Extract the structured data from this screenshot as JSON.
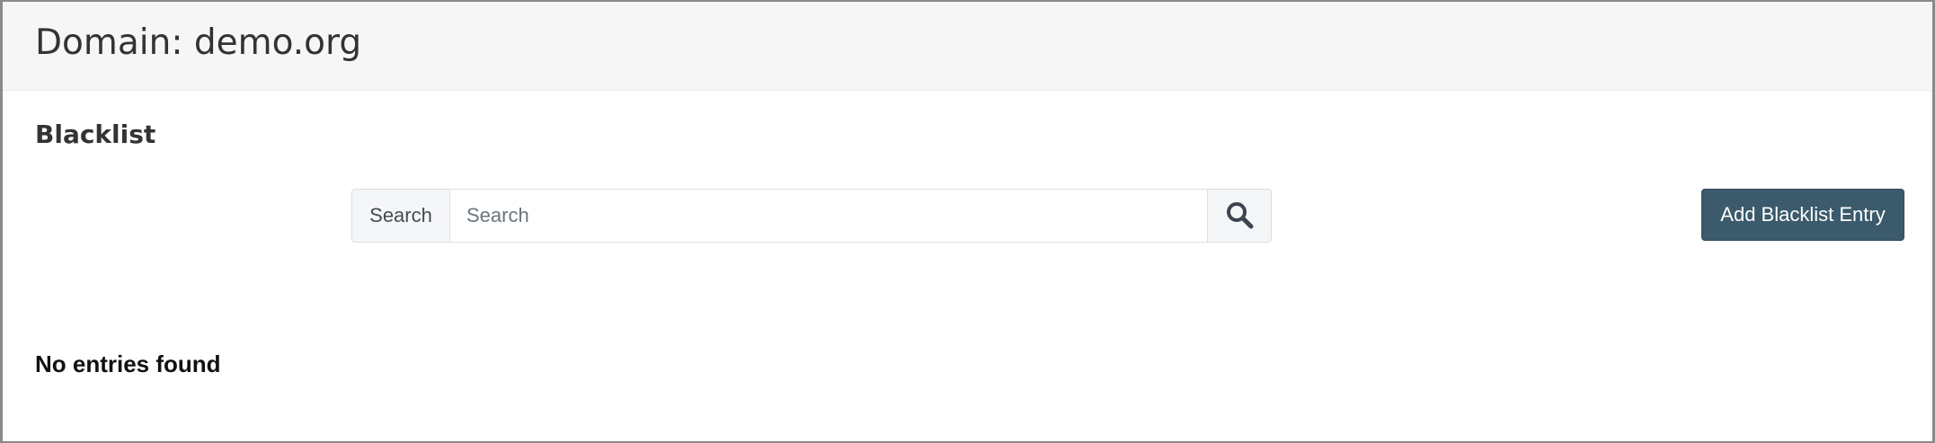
{
  "header": {
    "title": "Domain: demo.org"
  },
  "section": {
    "title": "Blacklist"
  },
  "search": {
    "label": "Search",
    "placeholder": "Search",
    "value": "",
    "button_icon": "search-icon"
  },
  "actions": {
    "add_label": "Add Blacklist Entry"
  },
  "results": {
    "empty_message": "No entries found"
  },
  "colors": {
    "header_bg": "#f6f6f6",
    "primary_button": "#3b5a6b",
    "icon": "#3d4451"
  }
}
